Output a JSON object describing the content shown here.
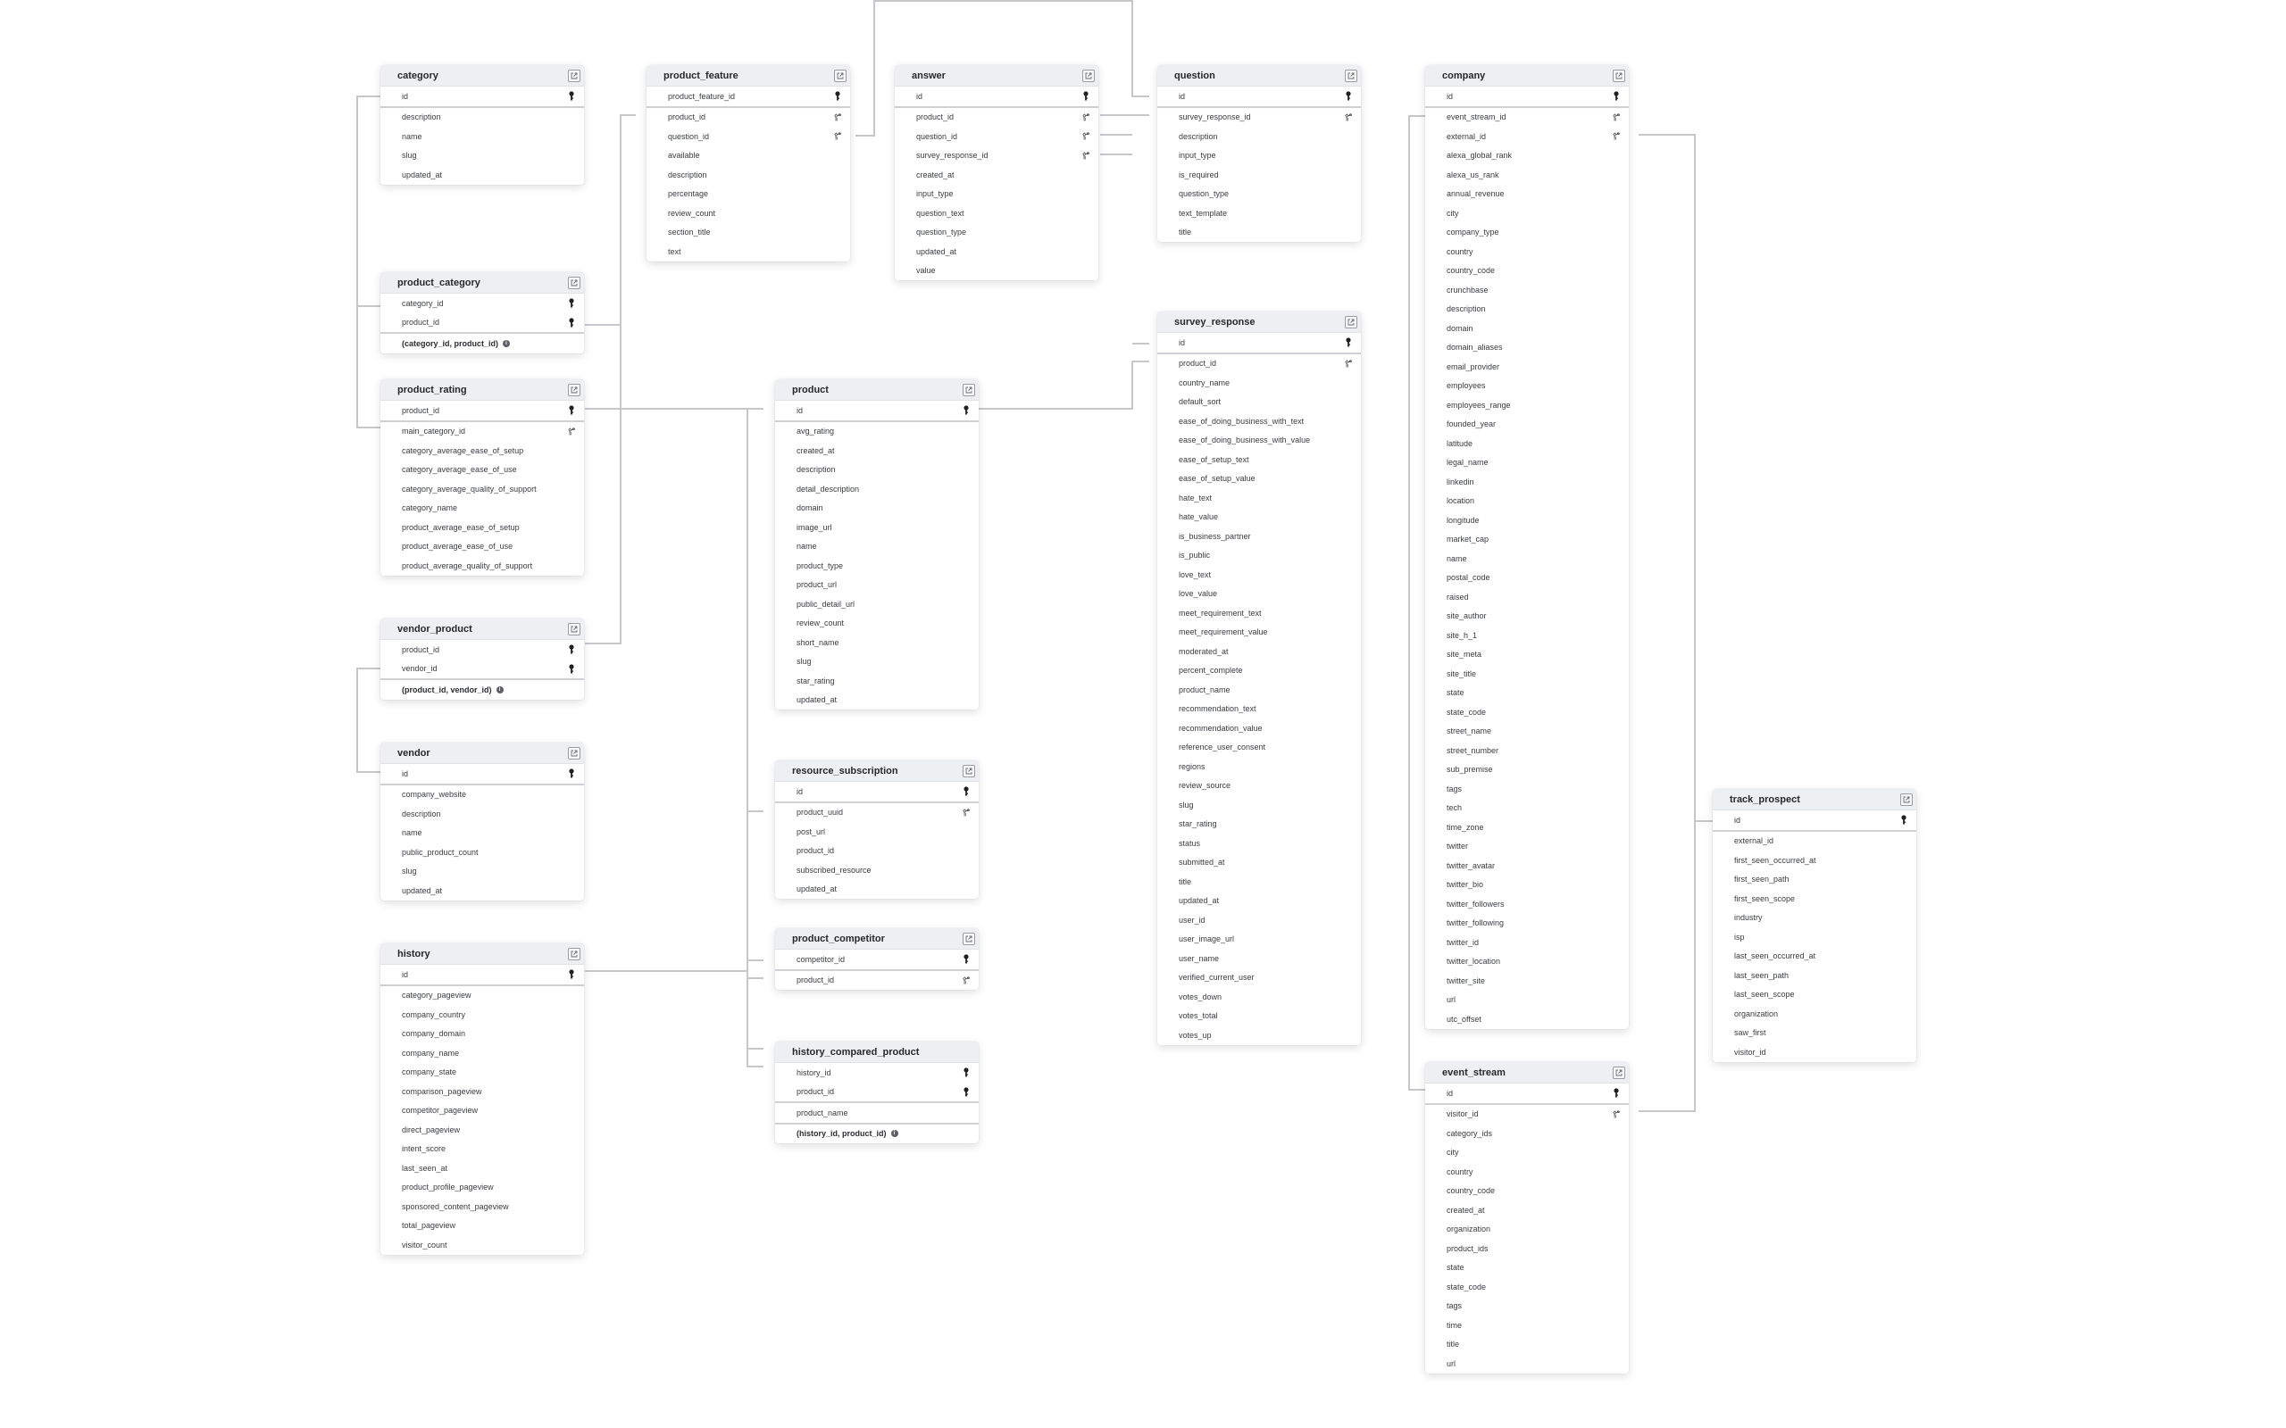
{
  "diagram": {
    "tables": [
      {
        "id": "category",
        "name": "category",
        "columns": [
          {
            "name": "id",
            "key": "pk"
          },
          {
            "name": "description"
          },
          {
            "name": "name"
          },
          {
            "name": "slug"
          },
          {
            "name": "updated_at"
          }
        ]
      },
      {
        "id": "product_category",
        "name": "product_category",
        "columns": [
          {
            "name": "category_id",
            "key": "pk"
          },
          {
            "name": "product_id",
            "key": "pk"
          }
        ],
        "index": "(category_id, product_id)"
      },
      {
        "id": "product_rating",
        "name": "product_rating",
        "columns": [
          {
            "name": "product_id",
            "key": "pk"
          },
          {
            "name": "main_category_id",
            "key": "fk"
          },
          {
            "name": "category_average_ease_of_setup"
          },
          {
            "name": "category_average_ease_of_use"
          },
          {
            "name": "category_average_quality_of_support"
          },
          {
            "name": "category_name"
          },
          {
            "name": "product_average_ease_of_setup"
          },
          {
            "name": "product_average_ease_of_use"
          },
          {
            "name": "product_average_quality_of_support"
          }
        ]
      },
      {
        "id": "vendor_product",
        "name": "vendor_product",
        "columns": [
          {
            "name": "product_id",
            "key": "pk"
          },
          {
            "name": "vendor_id",
            "key": "pk"
          }
        ],
        "index": "(product_id, vendor_id)"
      },
      {
        "id": "vendor",
        "name": "vendor",
        "columns": [
          {
            "name": "id",
            "key": "pk"
          },
          {
            "name": "company_website"
          },
          {
            "name": "description"
          },
          {
            "name": "name"
          },
          {
            "name": "public_product_count"
          },
          {
            "name": "slug"
          },
          {
            "name": "updated_at"
          }
        ]
      },
      {
        "id": "history",
        "name": "history",
        "columns": [
          {
            "name": "id",
            "key": "pk"
          },
          {
            "name": "category_pageview"
          },
          {
            "name": "company_country"
          },
          {
            "name": "company_domain"
          },
          {
            "name": "company_name"
          },
          {
            "name": "company_state"
          },
          {
            "name": "comparison_pageview"
          },
          {
            "name": "competitor_pageview"
          },
          {
            "name": "direct_pageview"
          },
          {
            "name": "intent_score"
          },
          {
            "name": "last_seen_at"
          },
          {
            "name": "product_profile_pageview"
          },
          {
            "name": "sponsored_content_pageview"
          },
          {
            "name": "total_pageview"
          },
          {
            "name": "visitor_count"
          }
        ]
      },
      {
        "id": "product_feature",
        "name": "product_feature",
        "columns": [
          {
            "name": "product_feature_id",
            "key": "pk"
          },
          {
            "name": "product_id",
            "key": "fk"
          },
          {
            "name": "question_id",
            "key": "fk"
          },
          {
            "name": "available"
          },
          {
            "name": "description"
          },
          {
            "name": "percentage"
          },
          {
            "name": "review_count"
          },
          {
            "name": "section_title"
          },
          {
            "name": "text"
          }
        ]
      },
      {
        "id": "answer",
        "name": "answer",
        "columns": [
          {
            "name": "id",
            "key": "pk"
          },
          {
            "name": "product_id",
            "key": "fk"
          },
          {
            "name": "question_id",
            "key": "fk"
          },
          {
            "name": "survey_response_id",
            "key": "fk"
          },
          {
            "name": "created_at"
          },
          {
            "name": "input_type"
          },
          {
            "name": "question_text"
          },
          {
            "name": "question_type"
          },
          {
            "name": "updated_at"
          },
          {
            "name": "value"
          }
        ]
      },
      {
        "id": "product",
        "name": "product",
        "columns": [
          {
            "name": "id",
            "key": "pk"
          },
          {
            "name": "avg_rating"
          },
          {
            "name": "created_at"
          },
          {
            "name": "description"
          },
          {
            "name": "detail_description"
          },
          {
            "name": "domain"
          },
          {
            "name": "image_url"
          },
          {
            "name": "name"
          },
          {
            "name": "product_type"
          },
          {
            "name": "product_url"
          },
          {
            "name": "public_detail_url"
          },
          {
            "name": "review_count"
          },
          {
            "name": "short_name"
          },
          {
            "name": "slug"
          },
          {
            "name": "star_rating"
          },
          {
            "name": "updated_at"
          }
        ]
      },
      {
        "id": "resource_subscription",
        "name": "resource_subscription",
        "columns": [
          {
            "name": "id",
            "key": "pk"
          },
          {
            "name": "product_uuid",
            "key": "fk"
          },
          {
            "name": "post_url"
          },
          {
            "name": "product_id"
          },
          {
            "name": "subscribed_resource"
          },
          {
            "name": "updated_at"
          }
        ]
      },
      {
        "id": "product_competitor",
        "name": "product_competitor",
        "columns": [
          {
            "name": "competitor_id",
            "key": "pk"
          },
          {
            "name": "product_id",
            "key": "fk"
          }
        ]
      },
      {
        "id": "history_compared_product",
        "name": "history_compared_product",
        "columns": [
          {
            "name": "history_id",
            "key": "pk"
          },
          {
            "name": "product_id",
            "key": "pk"
          },
          {
            "name": "product_name"
          }
        ],
        "index": "(history_id, product_id)"
      },
      {
        "id": "question",
        "name": "question",
        "columns": [
          {
            "name": "id",
            "key": "pk"
          },
          {
            "name": "survey_response_id",
            "key": "fk"
          },
          {
            "name": "description"
          },
          {
            "name": "input_type"
          },
          {
            "name": "is_required"
          },
          {
            "name": "question_type"
          },
          {
            "name": "text_template"
          },
          {
            "name": "title"
          }
        ]
      },
      {
        "id": "survey_response",
        "name": "survey_response",
        "columns": [
          {
            "name": "id",
            "key": "pk"
          },
          {
            "name": "product_id",
            "key": "fk"
          },
          {
            "name": "country_name"
          },
          {
            "name": "default_sort"
          },
          {
            "name": "ease_of_doing_business_with_text"
          },
          {
            "name": "ease_of_doing_business_with_value"
          },
          {
            "name": "ease_of_setup_text"
          },
          {
            "name": "ease_of_setup_value"
          },
          {
            "name": "hate_text"
          },
          {
            "name": "hate_value"
          },
          {
            "name": "is_business_partner"
          },
          {
            "name": "is_public"
          },
          {
            "name": "love_text"
          },
          {
            "name": "love_value"
          },
          {
            "name": "meet_requirement_text"
          },
          {
            "name": "meet_requirement_value"
          },
          {
            "name": "moderated_at"
          },
          {
            "name": "percent_complete"
          },
          {
            "name": "product_name"
          },
          {
            "name": "recommendation_text"
          },
          {
            "name": "recommendation_value"
          },
          {
            "name": "reference_user_consent"
          },
          {
            "name": "regions"
          },
          {
            "name": "review_source"
          },
          {
            "name": "slug"
          },
          {
            "name": "star_rating"
          },
          {
            "name": "status"
          },
          {
            "name": "submitted_at"
          },
          {
            "name": "title"
          },
          {
            "name": "updated_at"
          },
          {
            "name": "user_id"
          },
          {
            "name": "user_image_url"
          },
          {
            "name": "user_name"
          },
          {
            "name": "verified_current_user"
          },
          {
            "name": "votes_down"
          },
          {
            "name": "votes_total"
          },
          {
            "name": "votes_up"
          }
        ]
      },
      {
        "id": "company",
        "name": "company",
        "columns": [
          {
            "name": "id",
            "key": "pk"
          },
          {
            "name": "event_stream_id",
            "key": "fk"
          },
          {
            "name": "external_id",
            "key": "fk"
          },
          {
            "name": "alexa_global_rank"
          },
          {
            "name": "alexa_us_rank"
          },
          {
            "name": "annual_revenue"
          },
          {
            "name": "city"
          },
          {
            "name": "company_type"
          },
          {
            "name": "country"
          },
          {
            "name": "country_code"
          },
          {
            "name": "crunchbase"
          },
          {
            "name": "description"
          },
          {
            "name": "domain"
          },
          {
            "name": "domain_aliases"
          },
          {
            "name": "email_provider"
          },
          {
            "name": "employees"
          },
          {
            "name": "employees_range"
          },
          {
            "name": "founded_year"
          },
          {
            "name": "latitude"
          },
          {
            "name": "legal_name"
          },
          {
            "name": "linkedin"
          },
          {
            "name": "location"
          },
          {
            "name": "longitude"
          },
          {
            "name": "market_cap"
          },
          {
            "name": "name"
          },
          {
            "name": "postal_code"
          },
          {
            "name": "raised"
          },
          {
            "name": "site_author"
          },
          {
            "name": "site_h_1"
          },
          {
            "name": "site_meta"
          },
          {
            "name": "site_title"
          },
          {
            "name": "state"
          },
          {
            "name": "state_code"
          },
          {
            "name": "street_name"
          },
          {
            "name": "street_number"
          },
          {
            "name": "sub_premise"
          },
          {
            "name": "tags"
          },
          {
            "name": "tech"
          },
          {
            "name": "time_zone"
          },
          {
            "name": "twitter"
          },
          {
            "name": "twitter_avatar"
          },
          {
            "name": "twitter_bio"
          },
          {
            "name": "twitter_followers"
          },
          {
            "name": "twitter_following"
          },
          {
            "name": "twitter_id"
          },
          {
            "name": "twitter_location"
          },
          {
            "name": "twitter_site"
          },
          {
            "name": "url"
          },
          {
            "name": "utc_offset"
          }
        ]
      },
      {
        "id": "event_stream",
        "name": "event_stream",
        "columns": [
          {
            "name": "id",
            "key": "pk"
          },
          {
            "name": "visitor_id",
            "key": "fk"
          },
          {
            "name": "category_ids"
          },
          {
            "name": "city"
          },
          {
            "name": "country"
          },
          {
            "name": "country_code"
          },
          {
            "name": "created_at"
          },
          {
            "name": "organization"
          },
          {
            "name": "product_ids"
          },
          {
            "name": "state"
          },
          {
            "name": "state_code"
          },
          {
            "name": "tags"
          },
          {
            "name": "time"
          },
          {
            "name": "title"
          },
          {
            "name": "url"
          }
        ]
      },
      {
        "id": "track_prospect",
        "name": "track_prospect",
        "columns": [
          {
            "name": "id",
            "key": "pk"
          },
          {
            "name": "external_id"
          },
          {
            "name": "first_seen_occurred_at"
          },
          {
            "name": "first_seen_path"
          },
          {
            "name": "first_seen_scope"
          },
          {
            "name": "industry"
          },
          {
            "name": "isp"
          },
          {
            "name": "last_seen_occurred_at"
          },
          {
            "name": "last_seen_path"
          },
          {
            "name": "last_seen_scope"
          },
          {
            "name": "organization"
          },
          {
            "name": "saw_first"
          },
          {
            "name": "visitor_id"
          }
        ]
      }
    ],
    "relationships": [
      {
        "from": "category.id",
        "to": "product_category.category_id"
      },
      {
        "from": "category.id",
        "to": "product_rating.main_category_id"
      },
      {
        "from": "vendor.id",
        "to": "vendor_product.vendor_id"
      },
      {
        "from": "product.id",
        "to": "product_category.product_id"
      },
      {
        "from": "product.id",
        "to": "product_rating.product_id"
      },
      {
        "from": "product.id",
        "to": "vendor_product.product_id"
      },
      {
        "from": "product.id",
        "to": "product_feature.product_id"
      },
      {
        "from": "product.id",
        "to": "answer.product_id"
      },
      {
        "from": "product.id",
        "to": "survey_response.product_id"
      },
      {
        "from": "product.id",
        "to": "resource_subscription.product_uuid"
      },
      {
        "from": "product.id",
        "to": "product_competitor.competitor_id"
      },
      {
        "from": "product.id",
        "to": "product_competitor.product_id"
      },
      {
        "from": "product.id",
        "to": "history_compared_product.product_id"
      },
      {
        "from": "history.id",
        "to": "history_compared_product.history_id"
      },
      {
        "from": "question.id",
        "to": "product_feature.question_id"
      },
      {
        "from": "question.id",
        "to": "answer.question_id"
      },
      {
        "from": "survey_response.id",
        "to": "answer.survey_response_id"
      },
      {
        "from": "survey_response.id",
        "to": "question.survey_response_id"
      },
      {
        "from": "event_stream.id",
        "to": "company.event_stream_id"
      },
      {
        "from": "track_prospect.id",
        "to": "company.external_id"
      },
      {
        "from": "track_prospect.id",
        "to": "event_stream.visitor_id"
      }
    ]
  }
}
